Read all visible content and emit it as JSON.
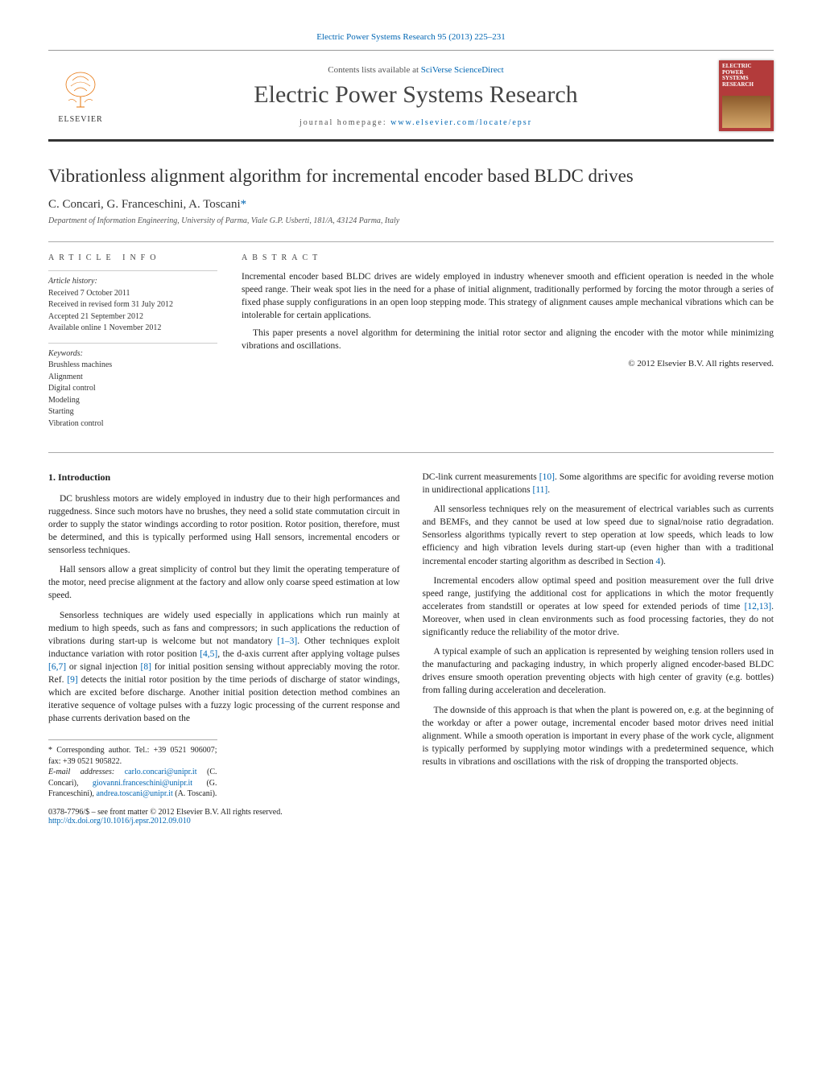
{
  "citation": "Electric Power Systems Research 95 (2013) 225–231",
  "header": {
    "publisher": "ELSEVIER",
    "contents_prefix": "Contents lists available at ",
    "contents_link": "SciVerse ScienceDirect",
    "journal_name": "Electric Power Systems Research",
    "homepage_prefix": "journal homepage: ",
    "homepage_link": "www.elsevier.com/locate/epsr",
    "cover_title": "ELECTRIC POWER SYSTEMS RESEARCH"
  },
  "title": "Vibrationless alignment algorithm for incremental encoder based BLDC drives",
  "authors": "C. Concari, G. Franceschini, A. Toscani",
  "corresponding_marker": "*",
  "affiliation": "Department of Information Engineering, University of Parma, Viale G.P. Usberti, 181/A, 43124 Parma, Italy",
  "article_info_label": "ARTICLE INFO",
  "abstract_label": "ABSTRACT",
  "history": {
    "label": "Article history:",
    "received": "Received 7 October 2011",
    "revised": "Received in revised form 31 July 2012",
    "accepted": "Accepted 21 September 2012",
    "online": "Available online 1 November 2012"
  },
  "keywords": {
    "label": "Keywords:",
    "items": [
      "Brushless machines",
      "Alignment",
      "Digital control",
      "Modeling",
      "Starting",
      "Vibration control"
    ]
  },
  "abstract": {
    "p1": "Incremental encoder based BLDC drives are widely employed in industry whenever smooth and efficient operation is needed in the whole speed range. Their weak spot lies in the need for a phase of initial alignment, traditionally performed by forcing the motor through a series of fixed phase supply configurations in an open loop stepping mode. This strategy of alignment causes ample mechanical vibrations which can be intolerable for certain applications.",
    "p2": "This paper presents a novel algorithm for determining the initial rotor sector and aligning the encoder with the motor while minimizing vibrations and oscillations.",
    "copyright": "© 2012 Elsevier B.V. All rights reserved."
  },
  "section1_heading": "1. Introduction",
  "body": {
    "c1p1": "DC brushless motors are widely employed in industry due to their high performances and ruggedness. Since such motors have no brushes, they need a solid state commutation circuit in order to supply the stator windings according to rotor position. Rotor position, therefore, must be determined, and this is typically performed using Hall sensors, incremental encoders or sensorless techniques.",
    "c1p2": "Hall sensors allow a great simplicity of control but they limit the operating temperature of the motor, need precise alignment at the factory and allow only coarse speed estimation at low speed.",
    "c1p3_a": "Sensorless techniques are widely used especially in applications which run mainly at medium to high speeds, such as fans and compressors; in such applications the reduction of vibrations during start-up is welcome but not mandatory ",
    "c1p3_r1": "[1–3]",
    "c1p3_b": ". Other techniques exploit inductance variation with rotor position ",
    "c1p3_r2": "[4,5]",
    "c1p3_c": ", the d-axis current after applying voltage pulses ",
    "c1p3_r3": "[6,7]",
    "c1p3_d": " or signal injection ",
    "c1p3_r4": "[8]",
    "c1p3_e": " for initial position sensing without appreciably moving the rotor. Ref. ",
    "c1p3_r5": "[9]",
    "c1p3_f": " detects the initial rotor position by the time periods of discharge of stator windings, which are excited before discharge. Another initial position detection method combines an iterative sequence of voltage pulses with a fuzzy logic processing of the current response and phase currents derivation based on the",
    "c2p1_a": "DC-link current measurements ",
    "c2p1_r1": "[10]",
    "c2p1_b": ". Some algorithms are specific for avoiding reverse motion in unidirectional applications ",
    "c2p1_r2": "[11]",
    "c2p1_c": ".",
    "c2p2_a": "All sensorless techniques rely on the measurement of electrical variables such as currents and BEMFs, and they cannot be used at low speed due to signal/noise ratio degradation. Sensorless algorithms typically revert to step operation at low speeds, which leads to low efficiency and high vibration levels during start-up (even higher than with a traditional incremental encoder starting algorithm as described in Section ",
    "c2p2_r1": "4",
    "c2p2_b": ").",
    "c2p3_a": "Incremental encoders allow optimal speed and position measurement over the full drive speed range, justifying the additional cost for applications in which the motor frequently accelerates from standstill or operates at low speed for extended periods of time ",
    "c2p3_r1": "[12,13]",
    "c2p3_b": ". Moreover, when used in clean environments such as food processing factories, they do not significantly reduce the reliability of the motor drive.",
    "c2p4": "A typical example of such an application is represented by weighing tension rollers used in the manufacturing and packaging industry, in which properly aligned encoder-based BLDC drives ensure smooth operation preventing objects with high center of gravity (e.g. bottles) from falling during acceleration and deceleration.",
    "c2p5": "The downside of this approach is that when the plant is powered on, e.g. at the beginning of the workday or after a power outage, incremental encoder based motor drives need initial alignment. While a smooth operation is important in every phase of the work cycle, alignment is typically performed by supplying motor windings with a predetermined sequence, which results in vibrations and oscillations with the risk of dropping the transported objects."
  },
  "footnotes": {
    "corr": "* Corresponding author. Tel.: +39 0521 906007; fax: +39 0521 905822.",
    "email_label": "E-mail addresses: ",
    "email1": "carlo.concari@unipr.it",
    "email1_who": " (C. Concari),",
    "email2": "giovanni.franceschini@unipr.it",
    "email2_who": " (G. Franceschini),",
    "email3": "andrea.toscani@unipr.it",
    "email3_who": " (A. Toscani)."
  },
  "doi": {
    "issn": "0378-7796/$ – see front matter © 2012 Elsevier B.V. All rights reserved.",
    "link": "http://dx.doi.org/10.1016/j.epsr.2012.09.010"
  }
}
